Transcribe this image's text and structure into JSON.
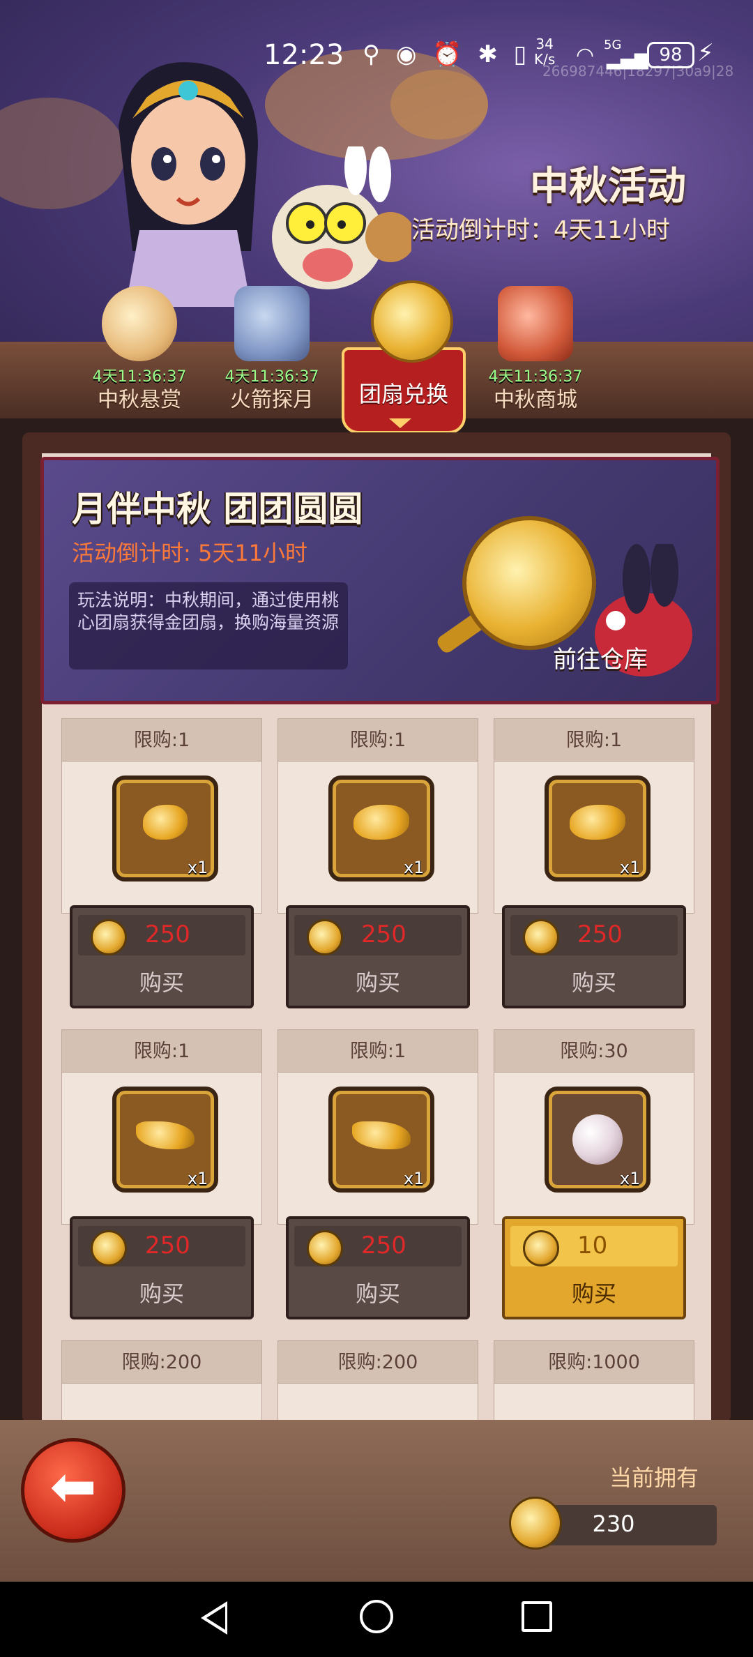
{
  "status_bar": {
    "time": "12:23",
    "net_speed_value": "34",
    "net_speed_unit": "K/s",
    "signal": "5G",
    "battery": "98",
    "id_text": "266987446|18297|30a9|28"
  },
  "header": {
    "title": "中秋活动",
    "countdown": "活动倒计时：4天11小时"
  },
  "tabs": [
    {
      "label": "中秋悬赏",
      "timer": "4天11:36:37",
      "icon": "cloud-icon",
      "active": false
    },
    {
      "label": "火箭探月",
      "timer": "4天11:36:37",
      "icon": "rocket-icon",
      "active": false
    },
    {
      "label": "团扇兑换",
      "timer": "",
      "icon": "fan-icon",
      "active": true
    },
    {
      "label": "中秋商城",
      "timer": "4天11:36:37",
      "icon": "gift-box-icon",
      "active": false
    }
  ],
  "hero": {
    "title": "月伴中秋 团团圆圆",
    "countdown": "活动倒计时: 5天11小时",
    "description": "玩法说明：中秋期间，通过使用桃心团扇获得金团扇，换购海量资源",
    "goto_label": "前往仓库"
  },
  "items": [
    {
      "limit": "限购:1",
      "qty": "x1",
      "price": "250",
      "buy": "购买",
      "icon": "goldfish-icon",
      "affordable": false
    },
    {
      "limit": "限购:1",
      "qty": "x1",
      "price": "250",
      "buy": "购买",
      "icon": "goldfish-icon",
      "affordable": false
    },
    {
      "limit": "限购:1",
      "qty": "x1",
      "price": "250",
      "buy": "购买",
      "icon": "goldfish-icon",
      "affordable": false
    },
    {
      "limit": "限购:1",
      "qty": "x1",
      "price": "250",
      "buy": "购买",
      "icon": "gold-fin-icon",
      "affordable": false
    },
    {
      "limit": "限购:1",
      "qty": "x1",
      "price": "250",
      "buy": "购买",
      "icon": "gold-fin-icon",
      "affordable": false
    },
    {
      "limit": "限购:30",
      "qty": "x1",
      "price": "10",
      "buy": "购买",
      "icon": "pearl-icon",
      "affordable": true
    },
    {
      "limit": "限购:200"
    },
    {
      "limit": "限购:200"
    },
    {
      "limit": "限购:1000"
    }
  ],
  "footer": {
    "owned_label": "当前拥有",
    "owned_value": "230"
  },
  "colors": {
    "price_unaffordable": "#e02828",
    "buy_gold": "#e3a72d",
    "active_tab": "#b51f1f"
  }
}
